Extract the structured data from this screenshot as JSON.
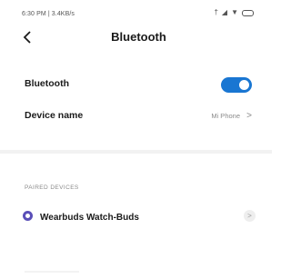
{
  "statusbar": {
    "time_text": "6:30 PM | 3.4KB/s"
  },
  "header": {
    "title": "Bluetooth",
    "back_label": "<"
  },
  "bluetooth_row": {
    "label": "Bluetooth",
    "toggle_on": true,
    "accent_color": "#1976d2"
  },
  "device_name_row": {
    "label": "Device name",
    "value": "Mi Phone",
    "chevron": ">"
  },
  "paired_section": {
    "title": "PAIRED DEVICES",
    "devices": [
      {
        "name": "Wearbuds Watch-Buds",
        "icon": "bluetooth-device-icon",
        "info_glyph": ">"
      }
    ]
  }
}
